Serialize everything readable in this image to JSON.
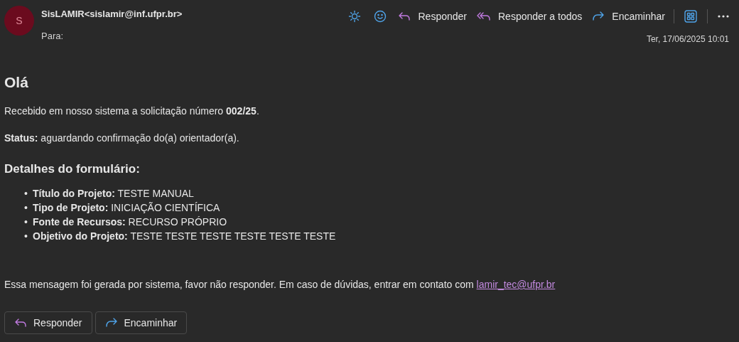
{
  "header": {
    "avatar_letter": "S",
    "sender_name": "SisLAMIR",
    "sender_email": "<sislamir@inf.ufpr.br>",
    "to_label": "Para:",
    "date": "Ter, 17/06/2025 10:01"
  },
  "toolbar": [
    {
      "kind": "sun"
    },
    {
      "kind": "emoji"
    },
    {
      "kind": "reply",
      "label": "Responder"
    },
    {
      "kind": "reply_all",
      "label": "Responder a todos"
    },
    {
      "kind": "forward",
      "label": "Encaminhar"
    },
    {
      "kind": "apps"
    },
    {
      "kind": "more"
    }
  ],
  "body": {
    "greeting": "Olá",
    "paragraphs": [
      "Recebido em nosso sistema a solicitação número **002/25**.",
      "**Status:** aguardando confirmação do(a) orientador(a)."
    ],
    "heading": "Detalhes do formulário:",
    "details": [
      {
        "marker": "•",
        "text": "**Título do Projeto:** TESTE MANUAL"
      },
      {
        "marker": "•",
        "text": "**Tipo de Projeto:** INICIAÇÃO CIENTÍFICA"
      },
      {
        "marker": "•",
        "text": "**Fonte de Recursos:** RECURSO PRÓPRIO"
      },
      {
        "marker": "•",
        "text": "**Objetivo do Projeto:** TESTE TESTE TESTE TESTE TESTE TESTE"
      }
    ],
    "footer_text": "Essa mensagem foi gerada por sistema, favor não responder. Em caso de dúvidas, entrar em contato com",
    "footer_link": "lamir_tec@ufpr.br"
  },
  "buttons": [
    {
      "kind": "reply",
      "label": "Responder"
    },
    {
      "kind": "forward",
      "label": "Encaminhar"
    }
  ]
}
